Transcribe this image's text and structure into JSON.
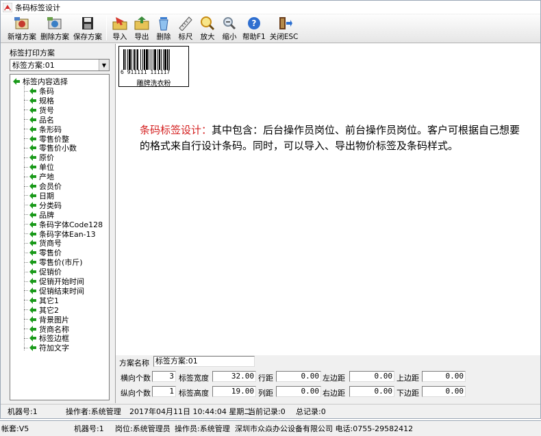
{
  "window": {
    "title": "条码标签设计"
  },
  "toolbar": {
    "buttons": [
      {
        "label": "新增方案",
        "icon": "new-plan-icon"
      },
      {
        "label": "删除方案",
        "icon": "delete-plan-icon"
      },
      {
        "label": "保存方案",
        "icon": "save-icon"
      },
      {
        "label": "导入",
        "icon": "import-icon"
      },
      {
        "label": "导出",
        "icon": "export-icon"
      },
      {
        "label": "删除",
        "icon": "delete-icon"
      },
      {
        "label": "标尺",
        "icon": "ruler-icon"
      },
      {
        "label": "放大",
        "icon": "zoom-in-icon"
      },
      {
        "label": "缩小",
        "icon": "zoom-out-icon"
      },
      {
        "label": "帮助F1",
        "icon": "help-icon"
      },
      {
        "label": "关闭ESC",
        "icon": "exit-icon"
      }
    ]
  },
  "left_panel": {
    "title": "标签打印方案",
    "scheme_select": "标签方案:01",
    "tree_root": "标签内容选择",
    "tree_items": [
      "条码",
      "规格",
      "货号",
      "品名",
      "条形码",
      "零售价整",
      "零售价小数",
      "原价",
      "单位",
      "产地",
      "会员价",
      "日期",
      "分类码",
      "品牌",
      "条码字体Code128",
      "条码字体Ean-13",
      "货商号",
      "零售价",
      "零售价(市斤)",
      "促销价",
      "促销开始时间",
      "促销结束时间",
      "其它1",
      "其它2",
      "背景图片",
      "货商名称",
      "标签边框",
      "符加文字"
    ]
  },
  "canvas": {
    "barcode": {
      "digits": "6  911111  111117",
      "caption": "雕牌洗衣粉"
    },
    "description_highlight": "条码标签设计：",
    "description_text": "其中包含：后台操作员岗位、前台操作员岗位。客户可根据自己想要的格式来自行设计条码。同时，可以导入、导出物价标签及条码样式。"
  },
  "props": {
    "scheme_name_label": "方案名称",
    "scheme_name_value": "标签方案:01",
    "row1": [
      {
        "label": "横向个数",
        "value": "3"
      },
      {
        "label": "标签宽度",
        "value": "32.00"
      },
      {
        "label": "行距",
        "value": "0.00"
      },
      {
        "label": "左边距",
        "value": "0.00"
      },
      {
        "label": "上边距",
        "value": "0.00"
      }
    ],
    "row2": [
      {
        "label": "纵向个数",
        "value": "1"
      },
      {
        "label": "标签高度",
        "value": "19.00"
      },
      {
        "label": "列距",
        "value": "0.00"
      },
      {
        "label": "右边距",
        "value": "0.00"
      },
      {
        "label": "下边距",
        "value": "0.00"
      }
    ]
  },
  "statusbar": {
    "machine": "机器号:1",
    "operator": "操作者:系统管理",
    "datetime": "2017年04月11日 10:44:04  星期二",
    "current_record": "当前记录:0",
    "total_record": "总记录:0"
  },
  "bottombar": {
    "account": "帐套:V5",
    "machine": "机器号:1",
    "post": "岗位:系统管理员",
    "operator": "操作员:系统管理",
    "company": "深圳市众焱办公设备有限公司 电话:0755-29582412"
  },
  "colors": {
    "highlight": "#d41f1f",
    "tree_icon": "#1a9a1a"
  }
}
